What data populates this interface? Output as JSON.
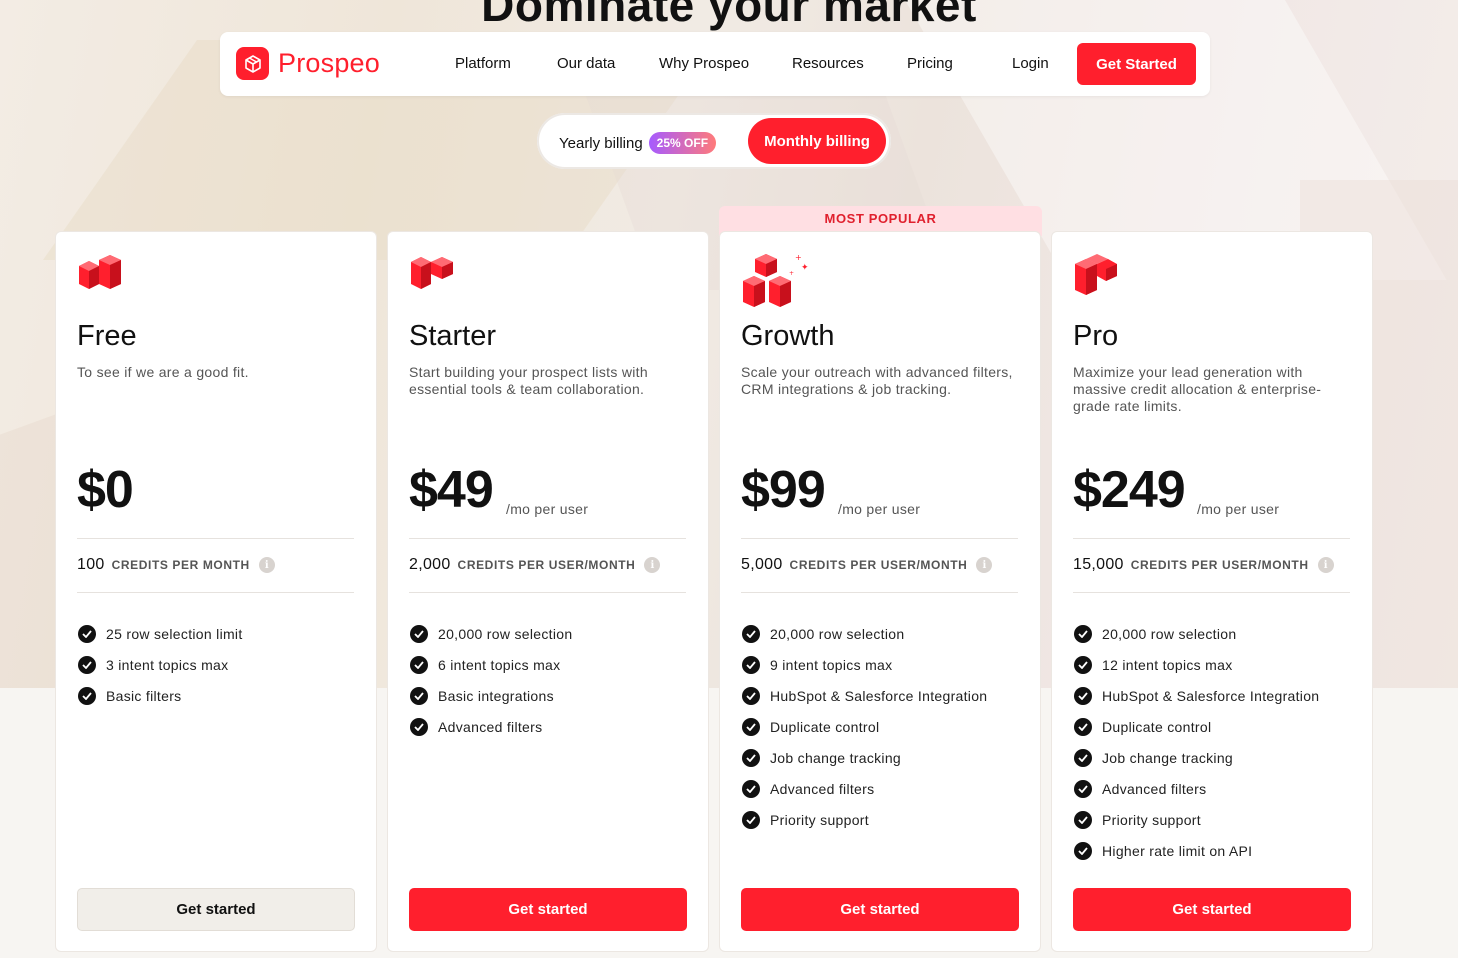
{
  "hero": {
    "title": "Dominate your market"
  },
  "nav": {
    "logo_text": "Prospeo",
    "links": [
      "Platform",
      "Our data",
      "Why Prospeo",
      "Resources",
      "Pricing"
    ],
    "login": "Login",
    "cta": "Get Started"
  },
  "billing": {
    "yearly_label": "Yearly billing",
    "discount_badge": "25% OFF",
    "monthly_label": "Monthly billing"
  },
  "popular_label": "MOST POPULAR",
  "plans": [
    {
      "name": "Free",
      "description": "To see if we are a good fit.",
      "price": "$0",
      "per": "",
      "credits_num": "100",
      "credits_label": "CREDITS PER MONTH",
      "features": [
        "25 row selection limit",
        "3 intent topics max",
        "Basic filters"
      ],
      "button": "Get started",
      "icon": "plan-free-cubes-icon"
    },
    {
      "name": "Starter",
      "description": "Start building your prospect lists with essential tools & team collaboration.",
      "price": "$49",
      "per": "/mo per user",
      "credits_num": "2,000",
      "credits_label": "CREDITS PER USER/MONTH",
      "features": [
        "20,000 row selection",
        "6 intent topics max",
        "Basic integrations",
        "Advanced filters"
      ],
      "button": "Get started",
      "icon": "plan-starter-cubes-icon"
    },
    {
      "name": "Growth",
      "description": "Scale your outreach with advanced filters, CRM integrations & job tracking.",
      "price": "$99",
      "per": "/mo per user",
      "credits_num": "5,000",
      "credits_label": "CREDITS PER USER/MONTH",
      "features": [
        "20,000 row selection",
        "9 intent topics max",
        "HubSpot & Salesforce Integration",
        "Duplicate control",
        "Job change tracking",
        "Advanced filters",
        "Priority support"
      ],
      "button": "Get started",
      "icon": "plan-growth-cubes-icon"
    },
    {
      "name": "Pro",
      "description": "Maximize your lead generation with massive credit allocation & enterprise-grade rate limits.",
      "price": "$249",
      "per": "/mo per user",
      "credits_num": "15,000",
      "credits_label": "CREDITS PER USER/MONTH",
      "features": [
        "20,000 row selection",
        "12 intent topics max",
        "HubSpot & Salesforce Integration",
        "Duplicate control",
        "Job change tracking",
        "Advanced filters",
        "Priority support",
        "Higher rate limit on API"
      ],
      "button": "Get started",
      "icon": "plan-pro-cubes-icon"
    }
  ],
  "colors": {
    "accent": "#ff1f2d",
    "popular_bg": "#ffdfe3",
    "popular_text": "#e0202e"
  }
}
